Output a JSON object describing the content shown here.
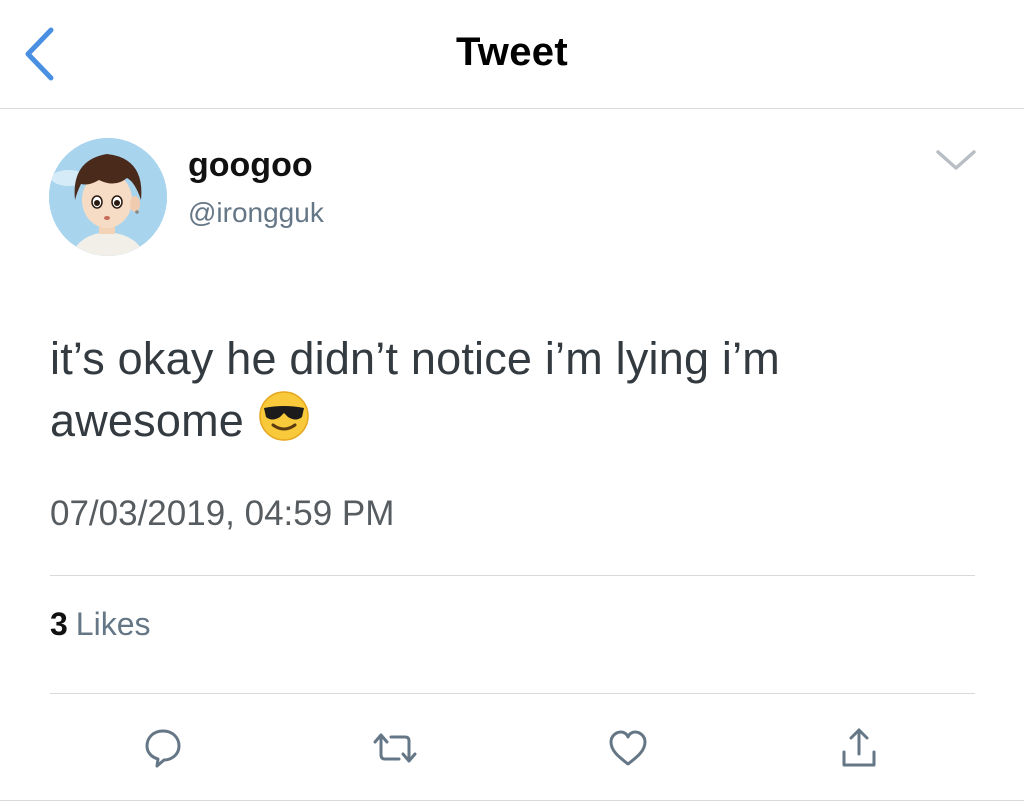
{
  "nav": {
    "title": "Tweet",
    "back_icon": "chevron-left-icon"
  },
  "author": {
    "display_name": "googoo",
    "handle": "@irongguk",
    "avatar_icon": "cartoon-boy-avatar",
    "menu_icon": "chevron-down-icon"
  },
  "tweet": {
    "text": "it’s okay he didn’t notice i’m lying i’m awesome",
    "emoji": "smiling-face-with-sunglasses",
    "timestamp": "07/03/2019, 04:59 PM"
  },
  "stats": {
    "likes_count": "3",
    "likes_label": "Likes"
  },
  "actions": [
    {
      "name": "reply",
      "icon": "reply-bubble-icon"
    },
    {
      "name": "retweet",
      "icon": "retweet-icon"
    },
    {
      "name": "like",
      "icon": "heart-icon"
    },
    {
      "name": "share",
      "icon": "share-icon"
    }
  ],
  "colors": {
    "accent": "#4a90e2",
    "secondary_text": "#657786",
    "icon_gray": "#657786"
  }
}
